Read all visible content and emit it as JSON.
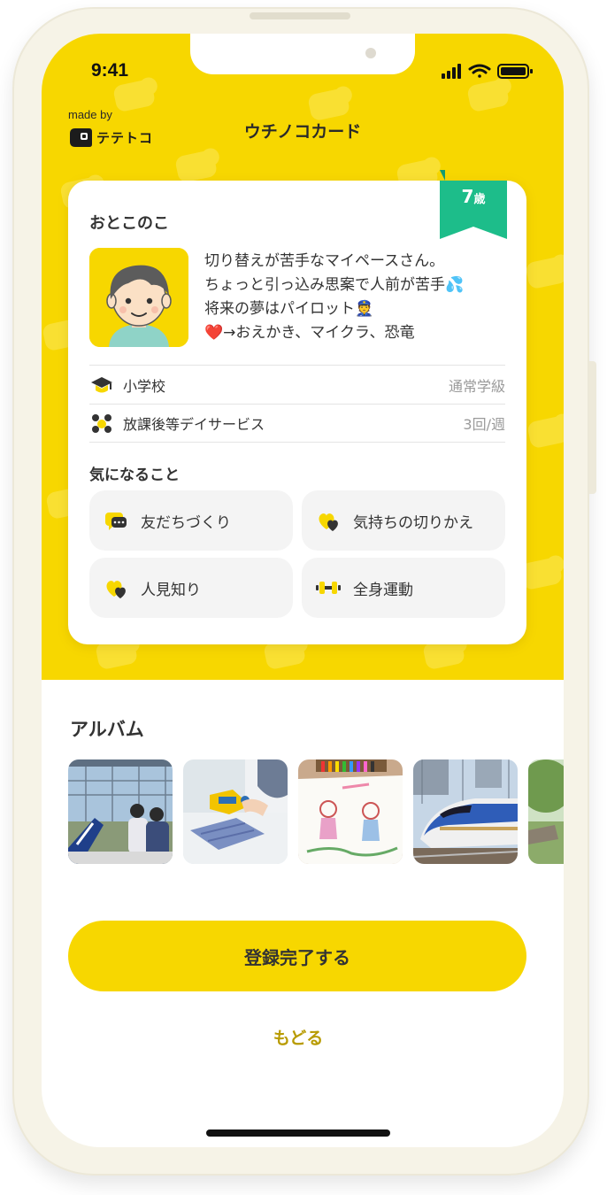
{
  "status_bar": {
    "time": "9:41"
  },
  "header": {
    "made_by": "made by",
    "brand": "テテトコ",
    "title": "ウチノコカード"
  },
  "card": {
    "age": {
      "number": "7",
      "unit": "歳"
    },
    "child_name": "おとこのこ",
    "intro_lines": [
      "切り替えが苦手なマイペースさん。",
      "ちょっと引っ込み思案で人前が苦手💦",
      "将来の夢はパイロット👮",
      "❤️→おえかき、マイクラ、恐竜"
    ],
    "info_rows": [
      {
        "icon": "graduation-cap-icon",
        "label": "小学校",
        "value": "通常学級"
      },
      {
        "icon": "people-group-icon",
        "label": "放課後等デイサービス",
        "value": "3回/週"
      }
    ],
    "concerns_title": "気になること",
    "concerns": [
      {
        "icon": "speech-bubble-icon",
        "label": "友だちづくり"
      },
      {
        "icon": "hearts-icon",
        "label": "気持ちの切りかえ"
      },
      {
        "icon": "hearts-icon",
        "label": "人見知り"
      },
      {
        "icon": "dumbbell-icon",
        "label": "全身運動"
      }
    ]
  },
  "album": {
    "title": "アルバム",
    "photos": [
      "airport-photo",
      "toy-model-photo",
      "drawing-photo",
      "bullet-train-photo",
      "park-photo"
    ]
  },
  "actions": {
    "submit_label": "登録完了する",
    "back_label": "もどる"
  },
  "colors": {
    "brand_yellow": "#f7d700",
    "ribbon_green": "#1dbd8a",
    "back_link": "#b89b00"
  }
}
